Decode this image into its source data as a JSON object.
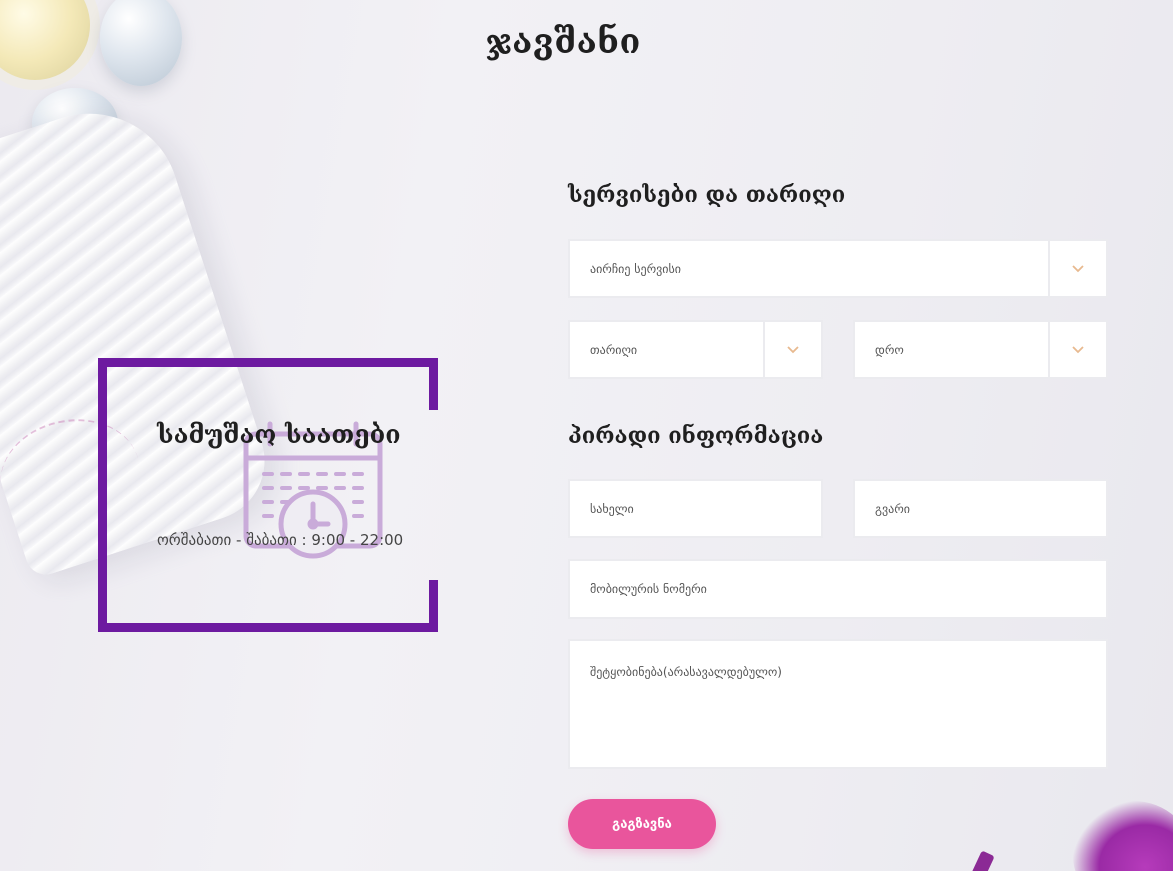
{
  "page": {
    "title": "ჯავშანი"
  },
  "hours": {
    "title": "სამუშაო საათები",
    "text": "ორშაბათი - შაბათი : 9:00 - 22:00"
  },
  "form": {
    "services_section_title": "სერვისები და თარიღი",
    "service_select": {
      "placeholder": "აირჩიე სერვისი"
    },
    "date_select": {
      "placeholder": "თარიღი"
    },
    "time_select": {
      "placeholder": "დრო"
    },
    "personal_section_title": "პირადი ინფორმაცია",
    "first_name": {
      "placeholder": "სახელი"
    },
    "last_name": {
      "placeholder": "გვარი"
    },
    "phone": {
      "placeholder": "მობილურის ნომერი"
    },
    "message": {
      "placeholder": "შეტყობინება(არასავალდებულო)"
    },
    "submit_label": "გაგზავნა"
  },
  "colors": {
    "accent_purple": "#6d1aa0",
    "button_pink": "#e9559c",
    "caret_color": "#e8b98f",
    "icon_lavender": "#c9abd9"
  },
  "icons": {
    "dropdown": "chevron-down-icon",
    "hours": "calendar-clock-icon"
  }
}
